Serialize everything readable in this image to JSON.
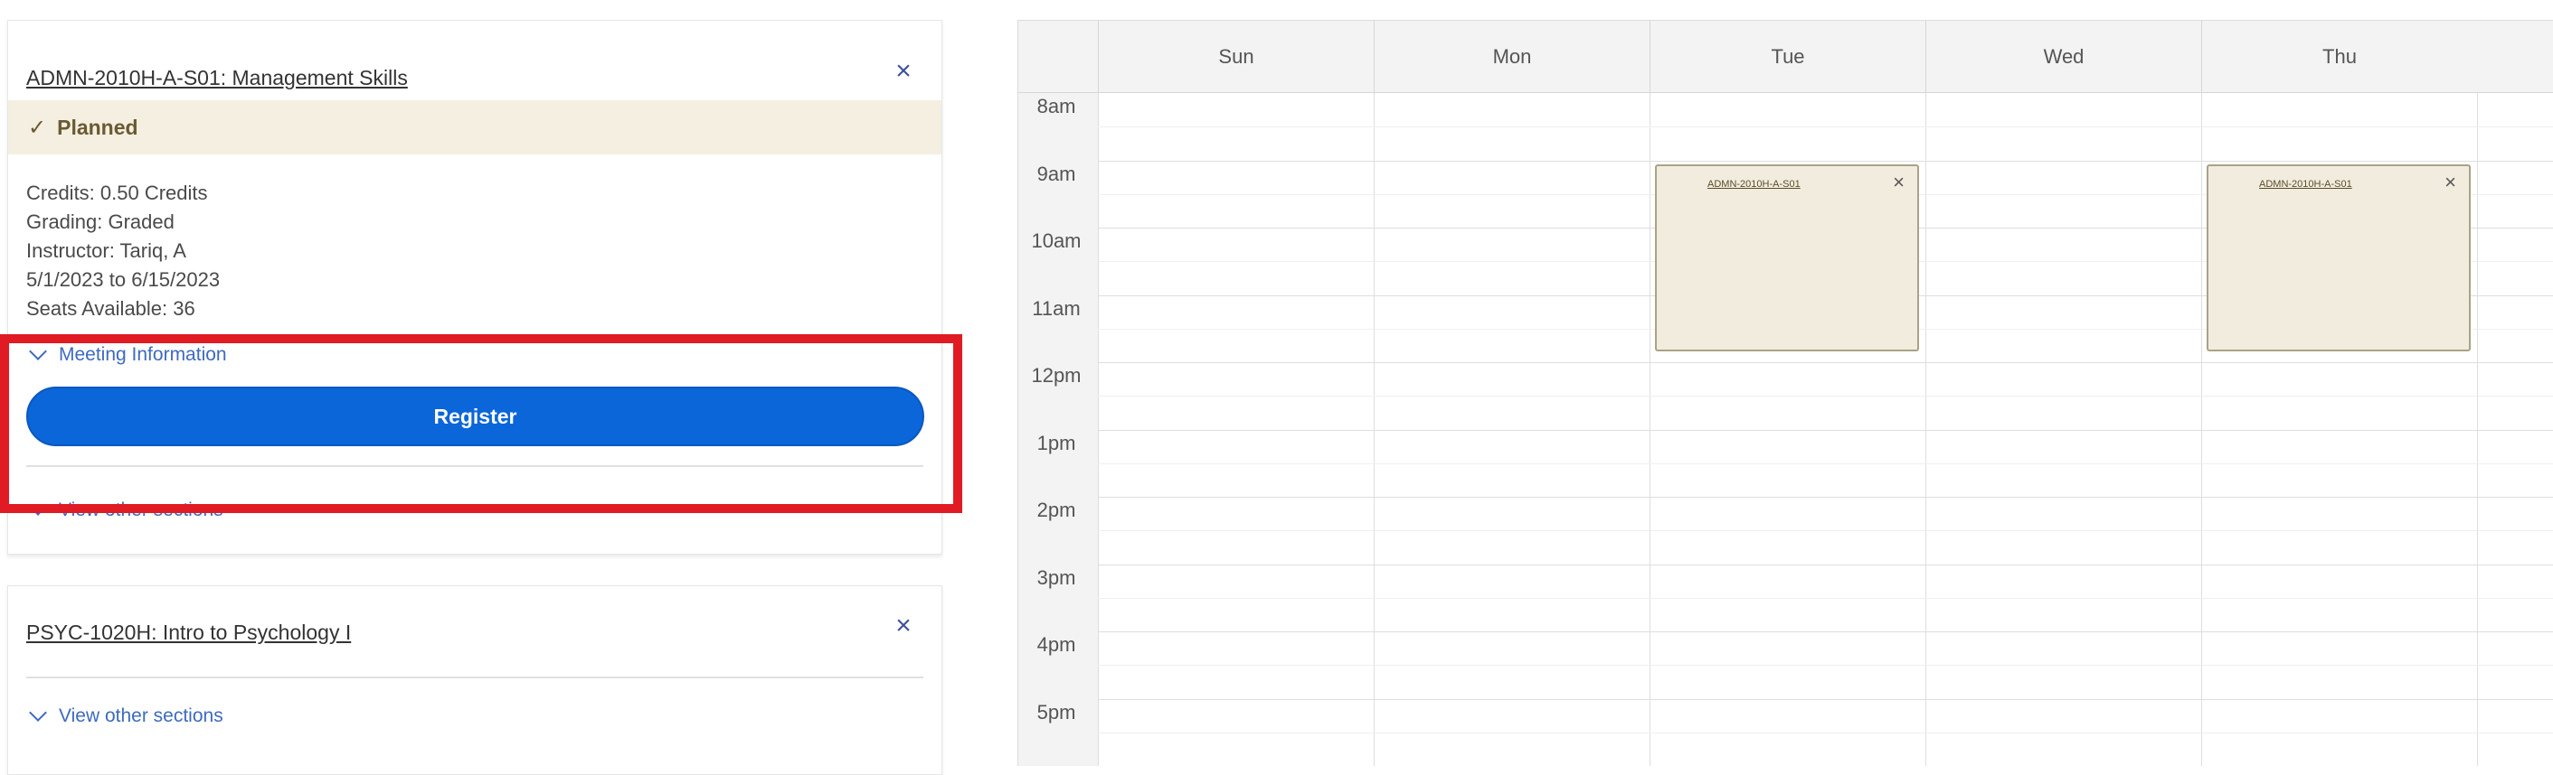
{
  "cards": [
    {
      "title": "ADMN-2010H-A-S01: Management Skills",
      "status": "Planned",
      "details": {
        "credits": "Credits: 0.50 Credits",
        "grading": "Grading: Graded",
        "instructor": "Instructor: Tariq, A",
        "dates": "5/1/2023 to 6/15/2023",
        "seats": "Seats Available:  36"
      },
      "meeting_label": "Meeting Information",
      "register_label": "Register",
      "other_sections_label": "View other sections"
    },
    {
      "title": "PSYC-1020H: Intro to Psychology I",
      "other_sections_label": "View other sections"
    }
  ],
  "icons": {
    "close": "×",
    "check": "✓"
  },
  "calendar": {
    "days": [
      "Sun",
      "Mon",
      "Tue",
      "Wed",
      "Thu"
    ],
    "times": [
      "8am",
      "9am",
      "10am",
      "11am",
      "12pm",
      "1pm",
      "2pm",
      "3pm",
      "4pm",
      "5pm"
    ],
    "events": [
      {
        "label": "ADMN-2010H-A-S01",
        "day": "Tue"
      },
      {
        "label": "ADMN-2010H-A-S01",
        "day": "Thu"
      }
    ]
  },
  "colors": {
    "register_button": "#0a66d9",
    "planned_banner": "#f4efe1",
    "highlight": "#e01b24",
    "link": "#3d6ac0",
    "event_fill": "#f2ecde"
  }
}
